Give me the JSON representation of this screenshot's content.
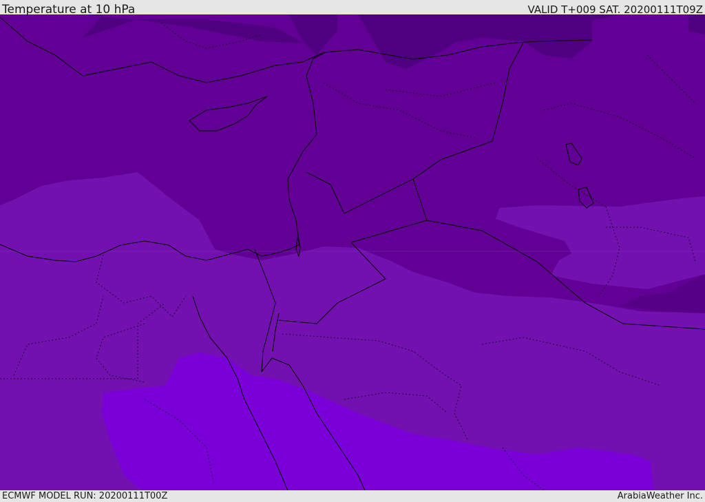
{
  "header": {
    "title": "Temperature at 10 hPa",
    "valid_time": "VALID T+009 SAT. 20200111T09Z"
  },
  "footer": {
    "model_run": "ECMWF MODEL RUN: 20200111T00Z",
    "credit": "ArabiaWeather Inc."
  },
  "colors": {
    "band_darkest": "#4f0080",
    "band_dark": "#620095",
    "band_mid": "#7310b0",
    "band_light": "#7a00d8",
    "borders": "#000000"
  }
}
